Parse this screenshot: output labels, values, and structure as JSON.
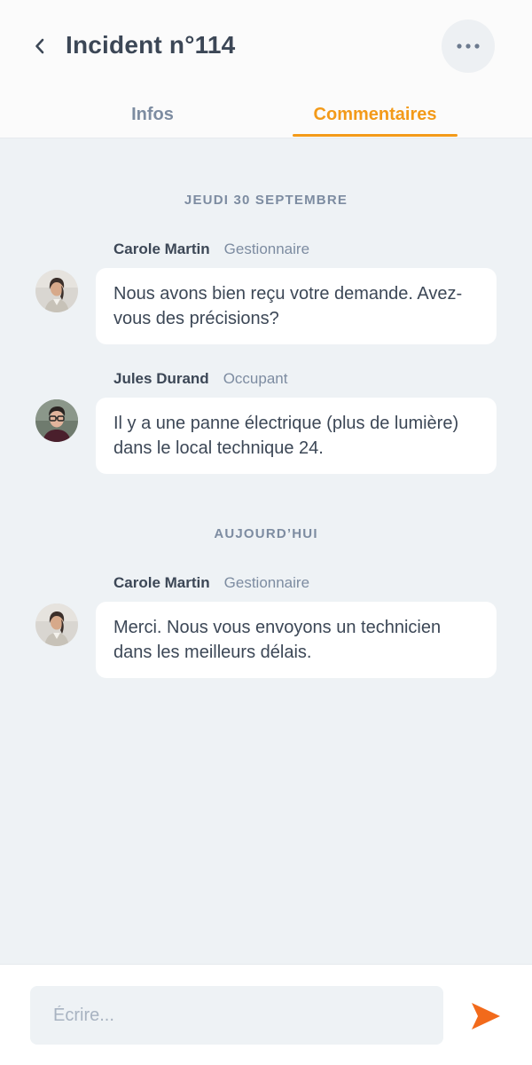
{
  "header": {
    "title": "Incident n°114",
    "back_icon": "chevron-left-icon",
    "more_icon": "more-horizontal-icon"
  },
  "tabs": [
    {
      "label": "Infos",
      "active": false
    },
    {
      "label": "Commentaires",
      "active": true
    }
  ],
  "colors": {
    "accent": "#f39a19",
    "send": "#f26a1b",
    "text": "#3c4756",
    "muted": "#7d8ca1",
    "background": "#eef2f5"
  },
  "feed": {
    "days": [
      {
        "label": "JEUDI 30 SEPTEMBRE",
        "messages": [
          {
            "author": "Carole Martin",
            "role": "Gestionnaire",
            "text": "Nous avons bien reçu votre demande. Avez-vous des précisions?"
          },
          {
            "author": "Jules Durand",
            "role": "Occupant",
            "text": "Il y a une panne électrique (plus de lumière) dans le local technique 24."
          }
        ]
      },
      {
        "label": "AUJOURD’HUI",
        "messages": [
          {
            "author": "Carole Martin",
            "role": "Gestionnaire",
            "text": "Merci. Nous vous envoyons un technicien dans les meilleurs délais."
          }
        ]
      }
    ]
  },
  "composer": {
    "placeholder": "Écrire...",
    "value": "",
    "send_icon": "send-icon"
  }
}
